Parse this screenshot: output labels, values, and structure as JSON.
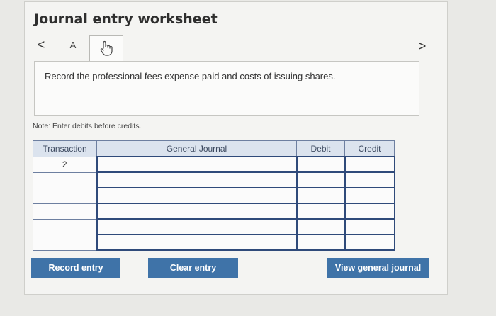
{
  "header": {
    "title": "Journal entry worksheet"
  },
  "nav": {
    "prev": "<",
    "next": ">",
    "tabs": [
      {
        "label": "A"
      }
    ]
  },
  "instruction": {
    "text": "Record the professional fees expense paid and costs of issuing shares."
  },
  "note": "Note: Enter debits before credits.",
  "table": {
    "columns": [
      "Transaction",
      "General Journal",
      "Debit",
      "Credit"
    ],
    "rows": [
      {
        "transaction": "2",
        "account": "",
        "debit": "",
        "credit": ""
      },
      {
        "transaction": "",
        "account": "",
        "debit": "",
        "credit": ""
      },
      {
        "transaction": "",
        "account": "",
        "debit": "",
        "credit": ""
      },
      {
        "transaction": "",
        "account": "",
        "debit": "",
        "credit": ""
      },
      {
        "transaction": "",
        "account": "",
        "debit": "",
        "credit": ""
      },
      {
        "transaction": "",
        "account": "",
        "debit": "",
        "credit": ""
      }
    ]
  },
  "buttons": {
    "record": "Record entry",
    "clear": "Clear entry",
    "view": "View general journal"
  },
  "colors": {
    "button": "#3f73a8",
    "header_bg": "#dbe3ee",
    "grid": "#6d7fa0"
  }
}
